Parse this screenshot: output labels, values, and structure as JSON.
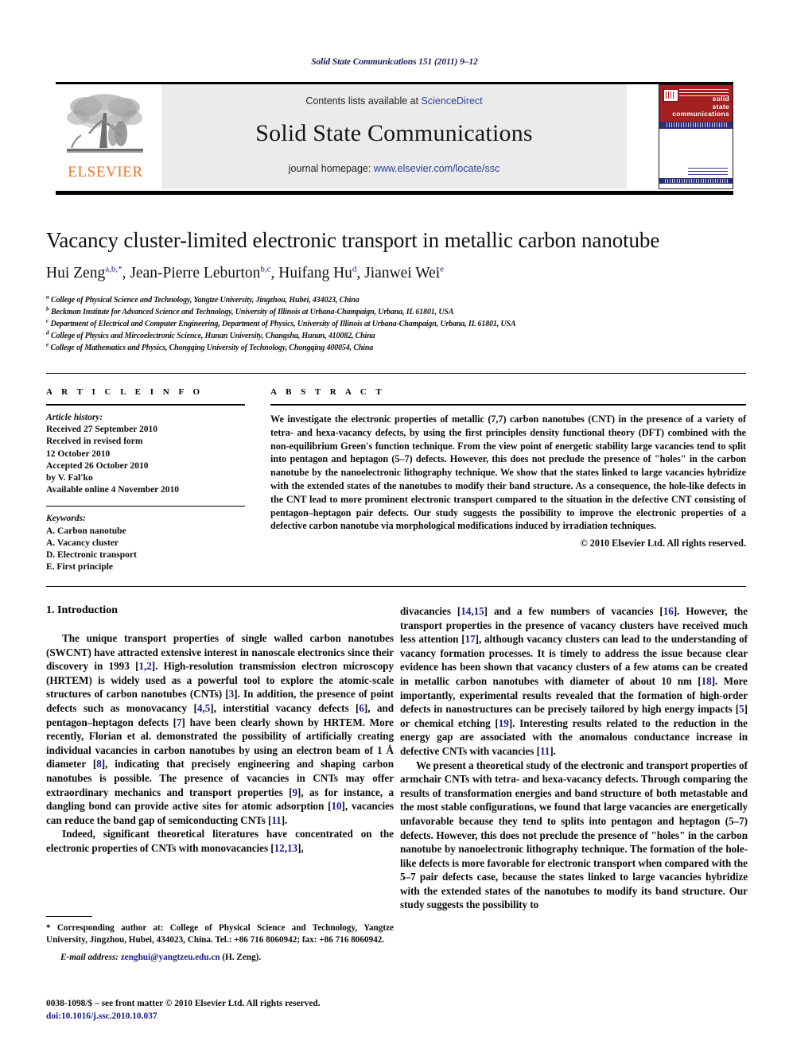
{
  "running_head": "Solid State Communications 151 (2011) 9–12",
  "masthead": {
    "publisher_logo_word": "ELSEVIER",
    "contents_prefix": "Contents lists available at ",
    "contents_link": "ScienceDirect",
    "journal_name": "Solid State Communications",
    "homepage_prefix": "journal homepage: ",
    "homepage_link": "www.elsevier.com/locate/ssc",
    "cover_title_line1": "solid",
    "cover_title_line2": "state",
    "cover_title_line3": "communications"
  },
  "article": {
    "title": "Vacancy cluster-limited electronic transport in metallic carbon nanotube",
    "authors": [
      {
        "name": "Hui Zeng",
        "sup": "a,b,*"
      },
      {
        "name": "Jean-Pierre Leburton",
        "sup": "b,c"
      },
      {
        "name": "Huifang Hu",
        "sup": "d"
      },
      {
        "name": "Jianwei Wei",
        "sup": "e"
      }
    ],
    "affiliations": [
      {
        "marker": "a",
        "text": "College of Physical Science and Technology, Yangtze University, Jingzhou, Hubei, 434023, China"
      },
      {
        "marker": "b",
        "text": "Beckman Institute for Advanced Science and Technology, University of Illinois at Urbana-Champaign, Urbana, IL 61801, USA"
      },
      {
        "marker": "c",
        "text": "Department of Electrical and Computer Engineering, Department of Physics, University of Illinois at Urbana-Champaign, Urbana, IL 61801, USA"
      },
      {
        "marker": "d",
        "text": "College of Physics and Mircoelectronic Science, Hunan University, Changsha, Hunan, 410082, China"
      },
      {
        "marker": "e",
        "text": "College of Mathematics and Physics, Chongqing University of Technology, Chongqing 400054, China"
      }
    ]
  },
  "article_info": {
    "heading": "A R T I C L E    I N F O",
    "history_label": "Article history:",
    "history": [
      "Received 27 September 2010",
      "Received in revised form",
      "12 October 2010",
      "Accepted 26 October 2010",
      "by V. Fal'ko",
      "Available online 4 November 2010"
    ],
    "keywords_label": "Keywords:",
    "keywords": [
      "A. Carbon nanotube",
      "A. Vacancy cluster",
      "D. Electronic transport",
      "E. First principle"
    ]
  },
  "abstract": {
    "heading": "A B S T R A C T",
    "text": "We investigate the electronic properties of metallic (7,7) carbon nanotubes (CNT) in the presence of a variety of tetra- and hexa-vacancy defects, by using the first principles density functional theory (DFT) combined with the non-equilibrium Green's function technique. From the view point of energetic stability large vacancies tend to split into pentagon and heptagon (5–7) defects. However, this does not preclude the presence of \"holes\" in the carbon nanotube by the nanoelectronic lithography technique. We show that the states linked to large vacancies hybridize with the extended states of the nanotubes to modify their band structure. As a consequence, the hole-like defects in the CNT lead to more prominent electronic transport compared to the situation in the defective CNT consisting of pentagon–heptagon pair defects. Our study suggests the possibility to improve the electronic properties of a defective carbon nanotube via morphological modifications induced by irradiation techniques.",
    "copyright": "© 2010 Elsevier Ltd. All rights reserved."
  },
  "body": {
    "section_heading": "1. Introduction",
    "left_paragraphs": [
      "The unique transport properties of single walled carbon nanotubes (SWCNT) have attracted extensive interest in nanoscale electronics since their discovery in 1993 [1,2]. High-resolution transmission electron microscopy (HRTEM) is widely used as a powerful tool to explore the atomic-scale structures of carbon nanotubes (CNTs) [3]. In addition, the presence of point defects such as monovacancy [4,5], interstitial vacancy defects [6], and pentagon–heptagon defects [7] have been clearly shown by HRTEM. More recently, Florian et al. demonstrated the possibility of artificially creating individual vacancies in carbon nanotubes by using an electron beam of 1 Å diameter [8], indicating that precisely engineering and shaping carbon nanotubes is possible. The presence of vacancies in CNTs may offer extraordinary mechanics and transport properties [9], as for instance, a dangling bond can provide active sites for atomic adsorption [10], vacancies can reduce the band gap of semiconducting CNTs [11].",
      "Indeed, significant theoretical literatures have concentrated on the electronic properties of CNTs with monovacancies [12,13],"
    ],
    "right_paragraphs": [
      "divacancies [14,15] and a few numbers of vacancies [16]. However, the transport properties in the presence of vacancy clusters have received much less attention [17], although vacancy clusters can lead to the understanding of vacancy formation processes. It is timely to address the issue because clear evidence has been shown that vacancy clusters of a few atoms can be created in metallic carbon nanotubes with diameter of about 10 nm [18]. More importantly, experimental results revealed that the formation of high-order defects in nanostructures can be precisely tailored by high energy impacts [5] or chemical etching [19]. Interesting results related to the reduction in the energy gap are associated with the anomalous conductance increase in defective CNTs with vacancies [11].",
      "We present a theoretical study of the electronic and transport properties of armchair CNTs with tetra- and hexa-vacancy defects. Through comparing the results of transformation energies and band structure of both metastable and the most stable configurations, we found that large vacancies are energetically unfavorable because they tend to splits into pentagon and heptagon (5–7) defects. However, this does not preclude the presence of \"holes\" in the carbon nanotube by nanoelectronic lithography technique. The formation of the hole-like defects is more favorable for electronic transport when compared with the 5–7 pair defects case, because the states linked to large vacancies hybridize with the extended states of the nanotubes to modify its band structure. Our study suggests the possibility to"
    ]
  },
  "footnote": {
    "corresponding": "* Corresponding author at: College of Physical Science and Technology, Yangtze University, Jingzhou, Hubei, 434023, China. Tel.: +86 716 8060942; fax: +86 716 8060942.",
    "email_label": "E-mail address:",
    "email": "zenghui@yangtzeu.edu.cn",
    "email_suffix": " (H. Zeng).",
    "issn_line": "0038-1098/$ – see front matter © 2010 Elsevier Ltd. All rights reserved.",
    "doi": "doi:10.1016/j.ssc.2010.10.037"
  }
}
